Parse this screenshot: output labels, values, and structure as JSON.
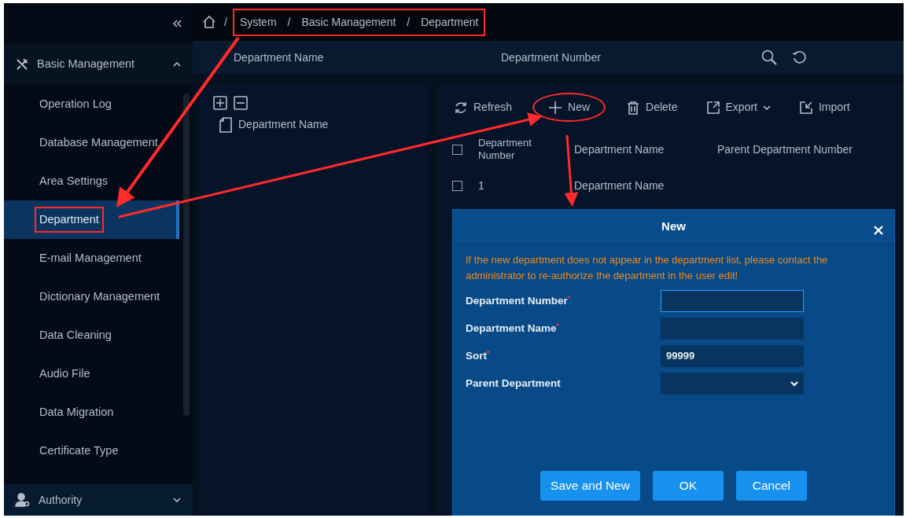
{
  "sidebar": {
    "group": {
      "label": "Basic Management",
      "expanded": true
    },
    "items": [
      {
        "label": "Operation Log",
        "selected": false,
        "highlighted": false
      },
      {
        "label": "Database Management",
        "selected": false,
        "highlighted": false
      },
      {
        "label": "Area Settings",
        "selected": false,
        "highlighted": false
      },
      {
        "label": "Department",
        "selected": true,
        "highlighted": true
      },
      {
        "label": "E-mail Management",
        "selected": false,
        "highlighted": false
      },
      {
        "label": "Dictionary Management",
        "selected": false,
        "highlighted": false
      },
      {
        "label": "Data Cleaning",
        "selected": false,
        "highlighted": false
      },
      {
        "label": "Audio File",
        "selected": false,
        "highlighted": false
      },
      {
        "label": "Data Migration",
        "selected": false,
        "highlighted": false
      },
      {
        "label": "Certificate Type",
        "selected": false,
        "highlighted": false
      }
    ],
    "footer_group": {
      "label": "Authority",
      "expanded": false
    }
  },
  "breadcrumb": {
    "highlighted": true,
    "items": [
      {
        "separator": "/",
        "label": "System"
      },
      {
        "separator": "/",
        "label": "Basic Management"
      },
      {
        "separator": "/",
        "label": "Department"
      }
    ]
  },
  "search": {
    "fields": [
      {
        "label": "Department Name"
      },
      {
        "label": "Department Number"
      }
    ]
  },
  "tree": {
    "nodes": [
      {
        "label": "Department Name"
      }
    ]
  },
  "toolbar": {
    "buttons": [
      {
        "kind": "refresh",
        "label": "Refresh",
        "highlighted": false
      },
      {
        "kind": "new",
        "label": "New",
        "highlighted": true
      },
      {
        "kind": "delete",
        "label": "Delete",
        "highlighted": false
      },
      {
        "kind": "export",
        "label": "Export",
        "highlighted": false
      },
      {
        "kind": "import",
        "label": "Import",
        "highlighted": false
      }
    ]
  },
  "table": {
    "header_checked": false,
    "columns": [
      "Department Number",
      "Department Name",
      "Parent Department Number"
    ],
    "rows": [
      {
        "selected": false,
        "number": "1",
        "name": "Department Name"
      }
    ]
  },
  "dialog": {
    "title": "New",
    "notice": "If the new department does not appear in the department list, please contact the administrator to re-authorize the department in the user edit!",
    "fields": [
      {
        "label": "Department Number",
        "required_mark": "*",
        "kind": "text",
        "focused": true
      },
      {
        "label": "Department Name",
        "required_mark": "*",
        "kind": "text",
        "focused": false
      },
      {
        "label": "Sort",
        "required_mark": "*",
        "kind": "text",
        "focused": false,
        "value": "99999"
      },
      {
        "label": "Parent Department",
        "kind": "select",
        "focused": false
      }
    ],
    "buttons": [
      "Save and New",
      "OK",
      "Cancel"
    ]
  }
}
